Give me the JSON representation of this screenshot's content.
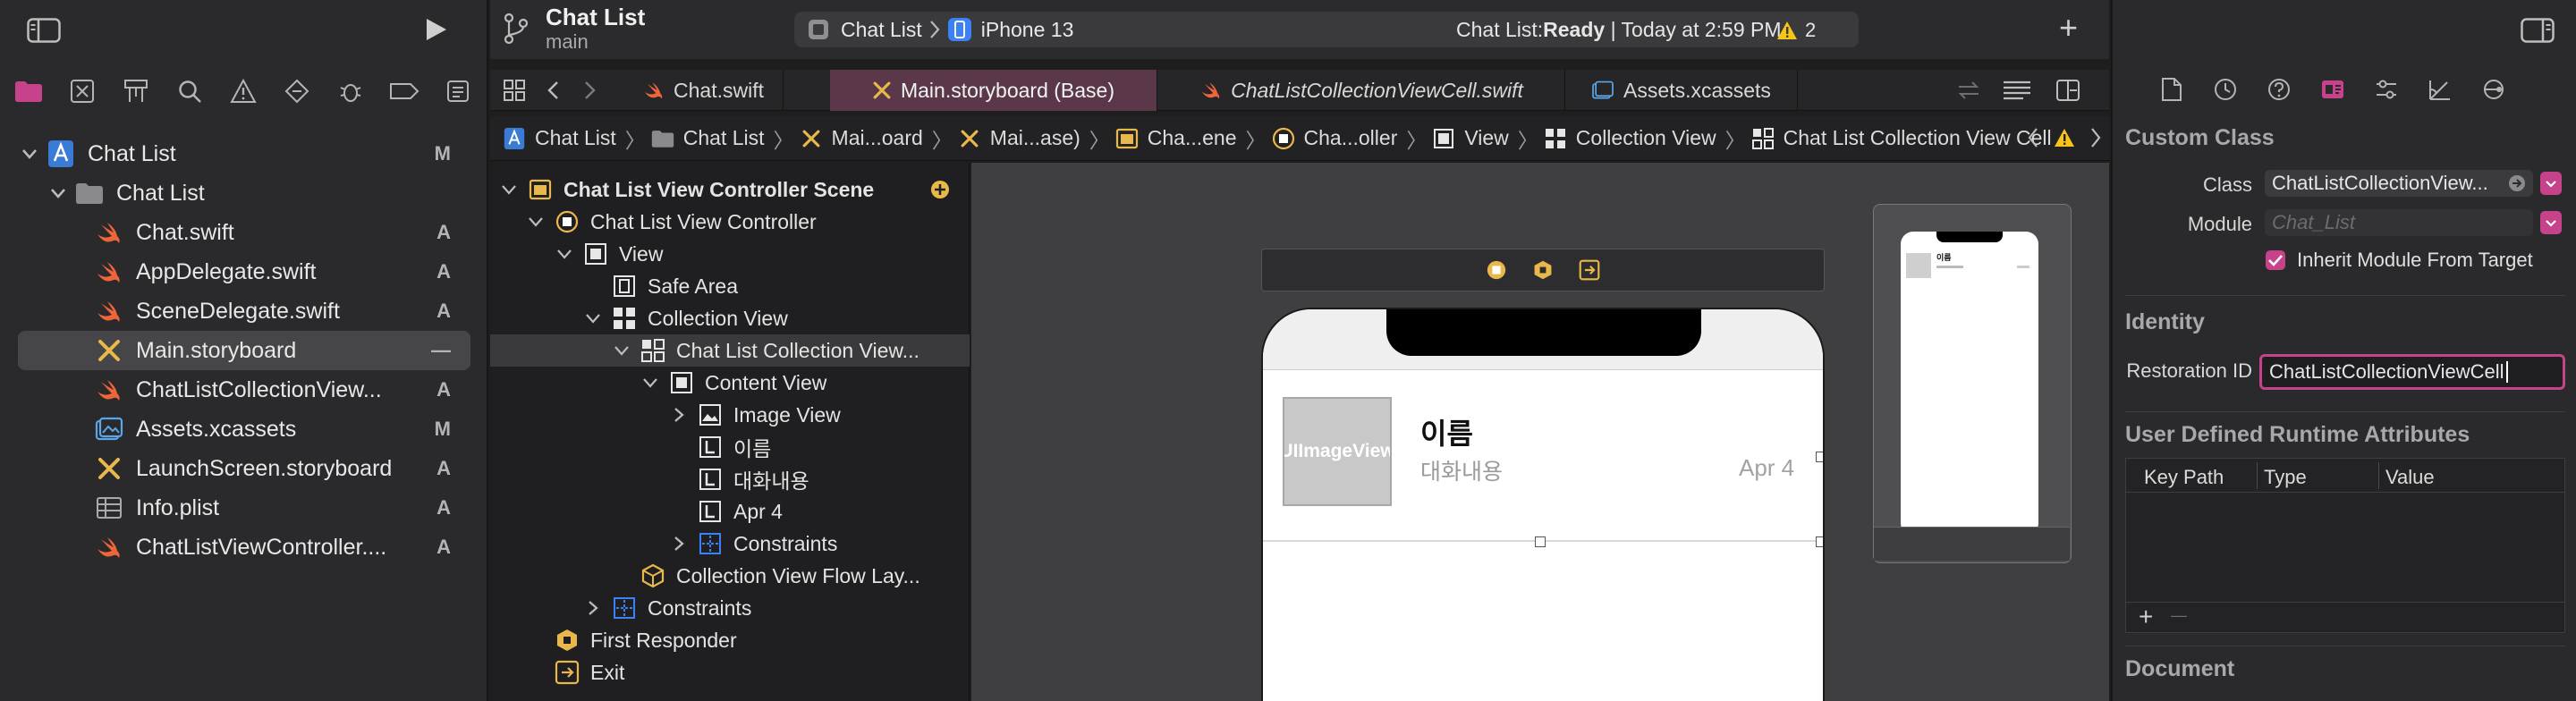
{
  "colors": {
    "accent": "#c6428a",
    "swift": "#f0643a",
    "storyboard": "#e8b84a",
    "folder": "#3a7bd5",
    "warning": "#f5c518"
  },
  "toolbar": {
    "project_title": "Chat List",
    "branch": "main",
    "scheme_name": "Chat List",
    "device_name": "iPhone 13",
    "status_prefix": "Chat List: ",
    "status_state": "Ready",
    "status_time": " | Today at 2:59 PM",
    "warning_count": "2",
    "add_label": "+"
  },
  "navigator": {
    "tabs": [
      "folder-icon",
      "source-control-icon",
      "symbol-icon",
      "search-icon",
      "issue-icon",
      "test-icon",
      "debug-icon",
      "breakpoint-icon",
      "report-icon"
    ],
    "tree": [
      {
        "name": "Chat List",
        "status": "M",
        "kind": "project",
        "indent": 0
      },
      {
        "name": "Chat List",
        "status": "",
        "kind": "folder",
        "indent": 1
      },
      {
        "name": "Chat.swift",
        "status": "A",
        "kind": "swift",
        "indent": 2
      },
      {
        "name": "AppDelegate.swift",
        "status": "A",
        "kind": "swift",
        "indent": 2
      },
      {
        "name": "SceneDelegate.swift",
        "status": "A",
        "kind": "swift",
        "indent": 2
      },
      {
        "name": "Main.storyboard",
        "status": "—",
        "kind": "storyboard",
        "indent": 2
      },
      {
        "name": "ChatListCollectionView...",
        "status": "A",
        "kind": "swift",
        "indent": 2
      },
      {
        "name": "Assets.xcassets",
        "status": "M",
        "kind": "assets",
        "indent": 2
      },
      {
        "name": "LaunchScreen.storyboard",
        "status": "A",
        "kind": "storyboard",
        "indent": 2
      },
      {
        "name": "Info.plist",
        "status": "A",
        "kind": "plist",
        "indent": 2
      },
      {
        "name": "ChatListViewController....",
        "status": "A",
        "kind": "swift",
        "indent": 2
      }
    ]
  },
  "tabs": [
    {
      "label": "Chat.swift",
      "kind": "swift"
    },
    {
      "label": "Main.storyboard (Base)",
      "kind": "storyboard"
    },
    {
      "label": "ChatListCollectionViewCell.swift",
      "kind": "swift"
    },
    {
      "label": "Assets.xcassets",
      "kind": "assets"
    }
  ],
  "jumpbar": [
    "Chat List",
    "Chat List",
    "Mai...oard",
    "Mai...ase)",
    "Cha...ene",
    "Cha...oller",
    "View",
    "Collection View",
    "Chat List Collection View Cell"
  ],
  "outline": [
    {
      "label": "Chat List View Controller Scene",
      "level": 0,
      "kind": "scene",
      "bold": true
    },
    {
      "label": "Chat List View Controller",
      "level": 1,
      "kind": "vc"
    },
    {
      "label": "View",
      "level": 2,
      "kind": "view"
    },
    {
      "label": "Safe Area",
      "level": 3,
      "kind": "safe"
    },
    {
      "label": "Collection View",
      "level": 3,
      "kind": "collection"
    },
    {
      "label": "Chat List Collection View...",
      "level": 4,
      "kind": "collection"
    },
    {
      "label": "Content View",
      "level": 5,
      "kind": "view"
    },
    {
      "label": "Image View",
      "level": 6,
      "kind": "image"
    },
    {
      "label": "이름",
      "level": 6,
      "kind": "label"
    },
    {
      "label": "대화내용",
      "level": 6,
      "kind": "label"
    },
    {
      "label": "Apr 4",
      "level": 6,
      "kind": "label"
    },
    {
      "label": "Constraints",
      "level": 6,
      "kind": "constraints"
    },
    {
      "label": "Collection View Flow Lay...",
      "level": 4,
      "kind": "flow"
    },
    {
      "label": "Constraints",
      "level": 3,
      "kind": "constraints"
    },
    {
      "label": "First Responder",
      "level": 1,
      "kind": "responder"
    },
    {
      "label": "Exit",
      "level": 1,
      "kind": "exit"
    }
  ],
  "canvas": {
    "cell_name": "이름",
    "cell_message": "대화내용",
    "cell_date": "Apr 4",
    "image_placeholder": "UIImageView",
    "mini_name": "이름"
  },
  "inspector": {
    "tabs": [
      "file-icon",
      "history-icon",
      "help-icon",
      "identity-icon",
      "attributes-icon",
      "size-icon",
      "connections-icon"
    ],
    "custom_class_title": "Custom Class",
    "class_label": "Class",
    "class_value": "ChatListCollectionView...",
    "module_label": "Module",
    "module_placeholder": "Chat_List",
    "inherit_label": "Inherit Module From Target",
    "identity_title": "Identity",
    "restoration_label": "Restoration ID",
    "restoration_value": "ChatListCollectionViewCell",
    "runtime_title": "User Defined Runtime Attributes",
    "col_keypath": "Key Path",
    "col_type": "Type",
    "col_value": "Value",
    "add_symbol": "+",
    "remove_symbol": "—",
    "document_title": "Document"
  }
}
